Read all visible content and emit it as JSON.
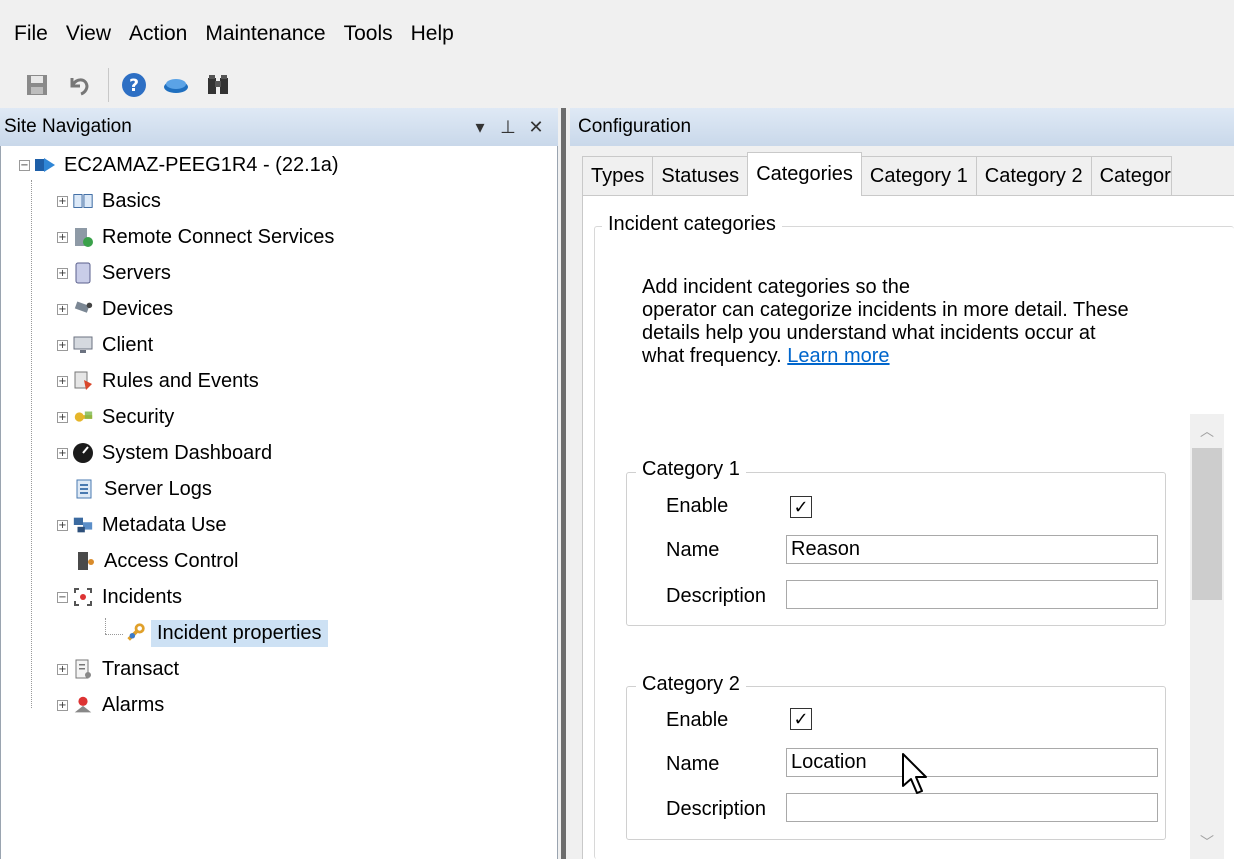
{
  "menu": [
    "File",
    "View",
    "Action",
    "Maintenance",
    "Tools",
    "Help"
  ],
  "toolbar": {
    "icons": [
      "save-icon",
      "undo-icon",
      "help-icon",
      "cloud-icon",
      "binoculars-icon"
    ]
  },
  "site_navigation": {
    "title": "Site Navigation",
    "controls": [
      "▾",
      "⊥",
      "✕"
    ],
    "root": "EC2AMAZ-PEEG1R4 - (22.1a)",
    "items": [
      {
        "label": "Basics",
        "icon": "book-icon"
      },
      {
        "label": "Remote Connect Services",
        "icon": "remote-server-icon"
      },
      {
        "label": "Servers",
        "icon": "server-icon"
      },
      {
        "label": "Devices",
        "icon": "camera-icon"
      },
      {
        "label": "Client",
        "icon": "monitor-icon"
      },
      {
        "label": "Rules and Events",
        "icon": "rules-icon"
      },
      {
        "label": "Security",
        "icon": "keys-icon"
      },
      {
        "label": "System Dashboard",
        "icon": "dashboard-icon"
      },
      {
        "label": "Server Logs",
        "icon": "logs-icon"
      },
      {
        "label": "Metadata Use",
        "icon": "metadata-icon"
      },
      {
        "label": "Access Control",
        "icon": "door-icon"
      },
      {
        "label": "Incidents",
        "icon": "incidents-icon"
      },
      {
        "label": "Incident properties",
        "icon": "wrench-icon"
      },
      {
        "label": "Transact",
        "icon": "receipt-icon"
      },
      {
        "label": "Alarms",
        "icon": "alarm-icon"
      }
    ]
  },
  "configuration": {
    "title": "Configuration",
    "tabs": [
      "Types",
      "Statuses",
      "Categories",
      "Category 1",
      "Category 2",
      "Categor"
    ],
    "active_tab": "Categories",
    "group_title": "Incident categories",
    "description_lines": [
      "Add incident categories so the",
      "operator can categorize incidents in more detail. These",
      "details help you understand what incidents occur at",
      "what frequency."
    ],
    "learn_more": "Learn more",
    "categories": [
      {
        "title": "Category 1",
        "enable_label": "Enable",
        "enabled": true,
        "name_label": "Name",
        "name_value": "Reason",
        "description_label": "Description",
        "description_value": ""
      },
      {
        "title": "Category 2",
        "enable_label": "Enable",
        "enabled": true,
        "name_label": "Name",
        "name_value": "Location",
        "description_label": "Description",
        "description_value": ""
      }
    ]
  }
}
